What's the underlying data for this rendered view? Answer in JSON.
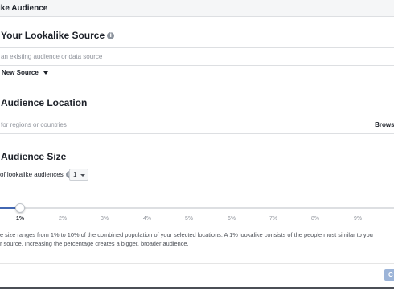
{
  "dialog": {
    "title": "ike Audience"
  },
  "source": {
    "title": "Your Lookalike Source",
    "placeholder": "an existing audience or data source",
    "new_source_label": "New Source"
  },
  "location": {
    "title": "Audience Location",
    "placeholder": "for regions or countries",
    "browse_label": "Browse"
  },
  "size": {
    "title": "Audience Size",
    "count_label": "of lookalike audiences",
    "count_value": "1",
    "slider_value": "1%",
    "ticks": [
      "1%",
      "2%",
      "3%",
      "4%",
      "5%",
      "6%",
      "7%",
      "8%",
      "9%"
    ],
    "help_line_1": "e size ranges from 1% to 10% of the combined population of your selected locations. A 1% lookalike consists of the people most similar to you",
    "help_line_2": "r source. Increasing the percentage creates a bigger, broader audience."
  },
  "footer": {
    "create_label": "C"
  }
}
